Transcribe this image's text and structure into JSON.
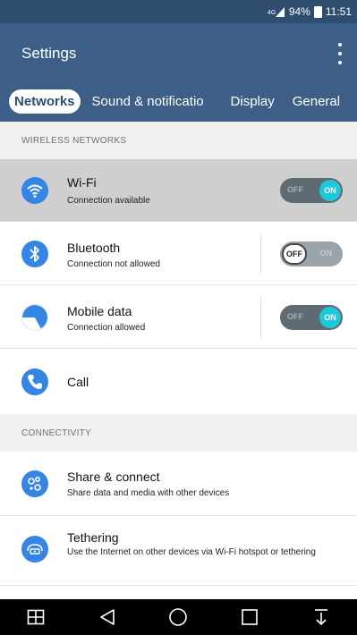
{
  "status_bar": {
    "battery_percent": "94%",
    "time": "11:51"
  },
  "app_bar": {
    "title": "Settings",
    "menu_icon": "more-vert-icon"
  },
  "tabs": [
    {
      "label": "Networks",
      "selected": true
    },
    {
      "label": "Sound & notificatio",
      "selected": false
    },
    {
      "label": "Display",
      "selected": false
    },
    {
      "label": "General",
      "selected": false
    }
  ],
  "sections": {
    "wireless": {
      "header": "WIRELESS NETWORKS"
    },
    "connectivity": {
      "header": "CONNECTIVITY"
    }
  },
  "rows": {
    "wifi": {
      "title": "Wi-Fi",
      "subtitle": "Connection available",
      "toggle": {
        "state": "on",
        "off_label": "OFF",
        "on_label": "ON"
      },
      "icon": "wifi-icon"
    },
    "bluetooth": {
      "title": "Bluetooth",
      "subtitle": "Connection not allowed",
      "toggle": {
        "state": "off",
        "off_label": "OFF",
        "on_label": "ON"
      },
      "icon": "bluetooth-icon"
    },
    "mobile_data": {
      "title": "Mobile data",
      "subtitle": "Connection allowed",
      "toggle": {
        "state": "on",
        "off_label": "OFF",
        "on_label": "ON"
      },
      "icon": "mobile-data-icon"
    },
    "call": {
      "title": "Call",
      "icon": "phone-icon"
    },
    "share": {
      "title": "Share & connect",
      "subtitle": "Share data and media with other devices",
      "icon": "share-connect-icon"
    },
    "tethering": {
      "title": "Tethering",
      "subtitle": "Use the Internet on other devices via Wi-Fi hotspot or tethering",
      "icon": "tethering-icon"
    }
  },
  "colors": {
    "status_bar": "#2f4d6f",
    "app_bar": "#3d5f87",
    "accent": "#1ec8d8",
    "icon_blue": "#3585e5"
  }
}
